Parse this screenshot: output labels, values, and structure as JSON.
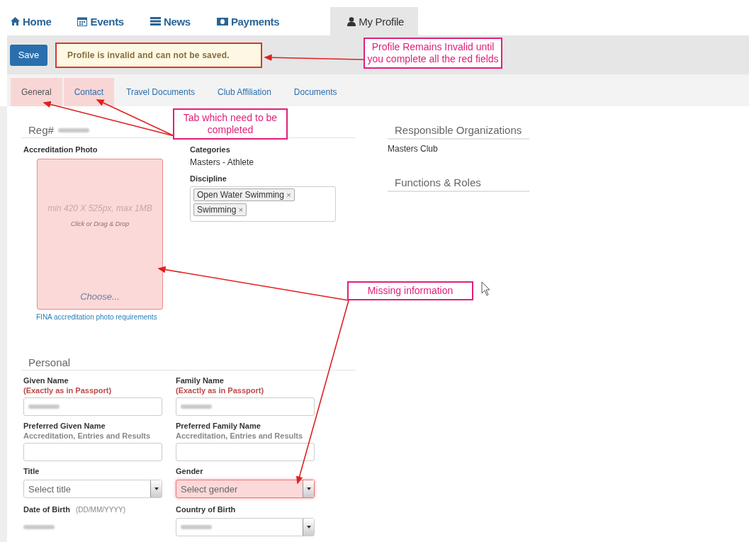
{
  "nav_tabs": [
    {
      "label": "Home",
      "selected": false
    },
    {
      "label": "Events",
      "selected": false
    },
    {
      "label": "News",
      "selected": false
    },
    {
      "label": "Payments",
      "selected": false
    },
    {
      "label": "My Profile",
      "selected": true
    }
  ],
  "toolbar": {
    "save_button": "Save",
    "alert": "Profile is invalid and can not be saved."
  },
  "sub_tabs": [
    {
      "label": "General",
      "selected": true,
      "incomplete": true
    },
    {
      "label": "Contact",
      "selected": false,
      "incomplete": true
    },
    {
      "label": "Travel Documents",
      "selected": false,
      "incomplete": false
    },
    {
      "label": "Club Affiliation",
      "selected": false,
      "incomplete": false
    },
    {
      "label": "Documents",
      "selected": false,
      "incomplete": false
    }
  ],
  "registration": {
    "label": "Reg#",
    "filled": true
  },
  "accreditation_photo": {
    "label": "Accreditation Photo",
    "hint": "min 420 X 525px, max 1MB",
    "sub_hint": "Click or Drag & Drop",
    "choose": "Choose...",
    "invalid": true,
    "link": "FINA accreditation photo requirements"
  },
  "categories": {
    "label": "Categories",
    "value": "Masters - Athlete"
  },
  "discipline": {
    "label": "Discipline",
    "tags": [
      {
        "label": "Open Water Swimming",
        "remove": "×"
      },
      {
        "label": "Swimming",
        "remove": "×"
      }
    ]
  },
  "side_sections": [
    {
      "title": "Responsible Organizations",
      "items": [
        "Masters Club"
      ]
    },
    {
      "title": "Functions & Roles"
    }
  ],
  "personal": {
    "title": "Personal",
    "fields": [
      {
        "kind": "text",
        "label": "Given Name",
        "note": "(Exactly as in Passport)",
        "note_required": true,
        "filled": true,
        "invalid": false
      },
      {
        "kind": "text",
        "label": "Family Name",
        "note": "(Exactly as in Passport)",
        "note_required": true,
        "filled": true,
        "invalid": false
      },
      {
        "kind": "text",
        "label": "Preferred Given Name",
        "note": "Accreditation, Entries and Results",
        "note_required": false,
        "filled": false,
        "invalid": false
      },
      {
        "kind": "text",
        "label": "Preferred Family Name",
        "note": "Accreditation, Entries and Results",
        "note_required": false,
        "filled": false,
        "invalid": false
      },
      {
        "kind": "select",
        "label": "Title",
        "placeholder": "Select title",
        "filled": false,
        "invalid": false
      },
      {
        "kind": "select",
        "label": "Gender",
        "placeholder": "Select gender",
        "filled": false,
        "invalid": true
      },
      {
        "kind": "static",
        "label": "Date of Birth",
        "format": "(DD/MM/YYYY)",
        "filled": true
      },
      {
        "kind": "select",
        "label": "Country of Birth",
        "filled": true,
        "invalid": false
      }
    ]
  },
  "annotations": [
    {
      "text": "Profile Remains Invalid until you complete all the red fields"
    },
    {
      "text": "Tab which need to be completed"
    },
    {
      "text": "Missing information"
    }
  ]
}
